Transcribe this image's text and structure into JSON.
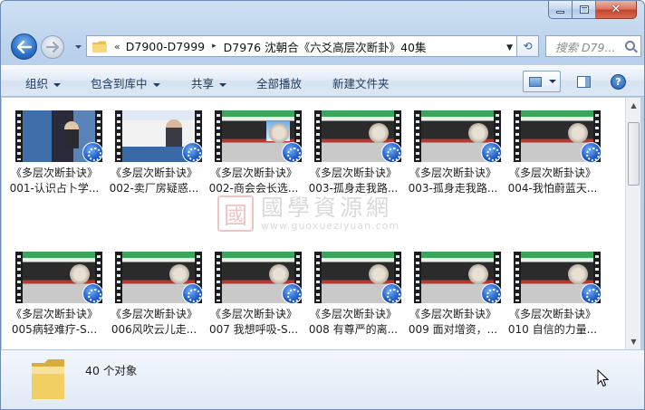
{
  "window": {
    "caption_buttons": {
      "minimize": "minimize",
      "maximize": "maximize",
      "close": "close"
    }
  },
  "address": {
    "overflow_glyph": "«",
    "crumbs": [
      "D7900-D7999",
      "D7976 沈朝合《六爻高层次断卦》40集"
    ],
    "separator": "▸",
    "dropdown": "▼",
    "refresh_glyph": "⟲",
    "search_placeholder": "搜索 D79..."
  },
  "toolbar": {
    "organize": "组织",
    "include_in_library": "包含到库中",
    "share": "共享",
    "play_all": "全部播放",
    "new_folder": "新建文件夹",
    "help": "?"
  },
  "watermark": {
    "seal": "國",
    "title": "國學資源網",
    "url": "www.guoxueziyuan.com"
  },
  "files": [
    {
      "line1": "《多层次断卦诀》",
      "line2": "001-认识占卜学...",
      "thumb": "studio"
    },
    {
      "line1": "《多层次断卦诀》",
      "line2": "002-卖厂房疑惑...",
      "thumb": "booth"
    },
    {
      "line1": "《多层次断卦诀》",
      "line2": "002-商会会长选...",
      "thumb": "green-sky"
    },
    {
      "line1": "《多层次断卦诀》",
      "line2": "003-孤身走我路...",
      "thumb": "green"
    },
    {
      "line1": "《多层次断卦诀》",
      "line2": "003-孤身走我路...",
      "thumb": "green"
    },
    {
      "line1": "《多层次断卦诀》",
      "line2": "004-我怕蔚蓝天...",
      "thumb": "green"
    },
    {
      "line1": "《多层次断卦诀》",
      "line2": "005病轻难疗-S...",
      "thumb": "green"
    },
    {
      "line1": "《多层次断卦诀》",
      "line2": "006风吹云儿走...",
      "thumb": "green"
    },
    {
      "line1": "《多层次断卦诀》",
      "line2": "007 我想呼吸-S...",
      "thumb": "green"
    },
    {
      "line1": "《多层次断卦诀》",
      "line2": "008 有尊严的离...",
      "thumb": "green"
    },
    {
      "line1": "《多层次断卦诀》",
      "line2": "009 面对增资，...",
      "thumb": "green"
    },
    {
      "line1": "《多层次断卦诀》",
      "line2": "010 自信的力量...",
      "thumb": "green"
    }
  ],
  "details": {
    "count_text": "40 个对象"
  },
  "colors": {
    "window_frame": "#b9d1ec",
    "command_text": "#1e395b",
    "accent": "#2a6fc8"
  }
}
